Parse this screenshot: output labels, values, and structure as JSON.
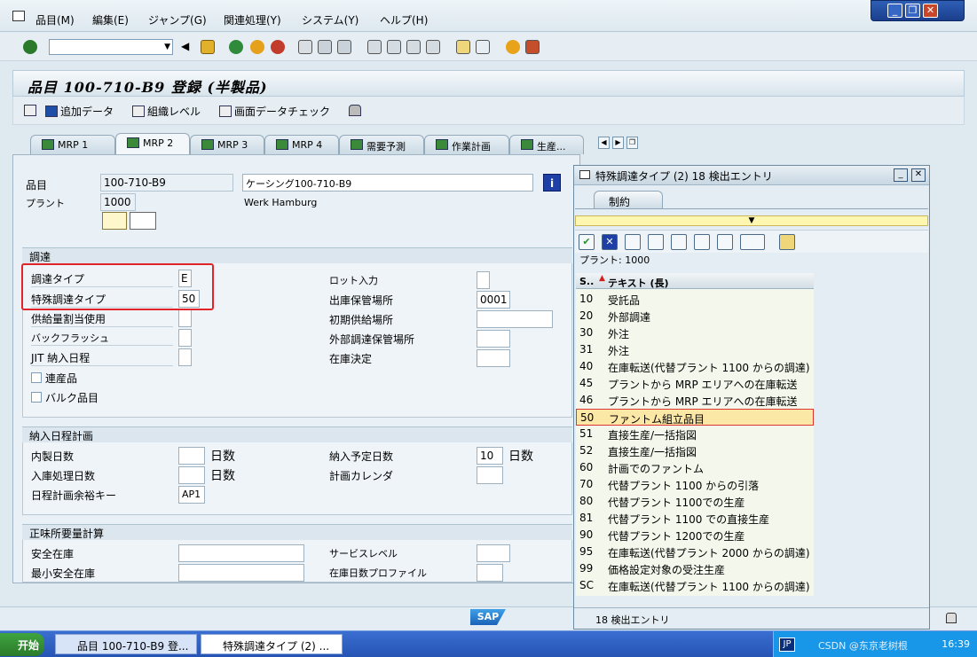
{
  "menu": {
    "items": [
      "品目(M)",
      "編集(E)",
      "ジャンプ(G)",
      "関連処理(Y)",
      "システム(Y)",
      "ヘルプ(H)"
    ]
  },
  "window_controls": [
    "minimize",
    "restore",
    "close"
  ],
  "command_field": {
    "value": ""
  },
  "title": "品目 100-710-B9 登録 (半製品)",
  "app_toolbar": {
    "additional_data": "追加データ",
    "org_levels": "組織レベル",
    "check_screen_data": "画面データチェック"
  },
  "tabs": [
    "MRP 1",
    "MRP 2",
    "MRP 3",
    "MRP 4",
    "需要予測",
    "作業計画",
    "生産..."
  ],
  "active_tab": "MRP 2",
  "header": {
    "material_label": "品目",
    "material_value": "100-710-B9",
    "material_desc": "ケーシング100-710-B9",
    "plant_label": "プラント",
    "plant_value": "1000",
    "plant_name": "Werk Hamburg"
  },
  "procurement": {
    "title": "調達",
    "proc_type_label": "調達タイプ",
    "proc_type_value": "E",
    "special_proc_label": "特殊調達タイプ",
    "special_proc_value": "50",
    "quota_label": "供給量割当使用",
    "backflush_label": "バックフラッシュ",
    "jit_label": "JIT 納入日程",
    "coproduct_label": "連産品",
    "bulk_label": "バルク品目",
    "batch_entry_label": "ロット入力",
    "prod_stor_label": "出庫保管場所",
    "prod_stor_value": "0001",
    "default_supply_label": "初期供給場所",
    "ext_stor_label": "外部調達保管場所",
    "stock_det_label": "在庫決定"
  },
  "scheduling": {
    "title": "納入日程計画",
    "inhouse_label": "内製日数",
    "gr_label": "入庫処理日数",
    "margin_label": "日程計画余裕キー",
    "margin_value": "AP1",
    "days_unit": "日数",
    "planned_del_label": "納入予定日数",
    "planned_del_value": "10",
    "calendar_label": "計画カレンダ"
  },
  "net_req": {
    "title": "正味所要量計算",
    "safety_label": "安全在庫",
    "min_safety_label": "最小安全在庫",
    "service_label": "サービスレベル",
    "coverage_label": "在庫日数プロファイル"
  },
  "popup": {
    "title": "特殊調達タイプ (2)   18 検出エントリ",
    "tab": "制約",
    "plant_line": "プラント: 1000",
    "col1": "S..",
    "col2": "テキスト (長)",
    "rows": [
      {
        "code": "10",
        "text": "受託品"
      },
      {
        "code": "20",
        "text": "外部調達"
      },
      {
        "code": "30",
        "text": "外注"
      },
      {
        "code": "31",
        "text": "外注"
      },
      {
        "code": "40",
        "text": "在庫転送(代替プラント 1100 からの調達)"
      },
      {
        "code": "45",
        "text": "プラントから MRP エリアへの在庫転送"
      },
      {
        "code": "46",
        "text": "プラントから MRP エリアへの在庫転送"
      },
      {
        "code": "50",
        "text": "ファントム組立品目"
      },
      {
        "code": "51",
        "text": "直接生産/一括指図"
      },
      {
        "code": "52",
        "text": "直接生産/一括指図"
      },
      {
        "code": "60",
        "text": "計画でのファントム"
      },
      {
        "code": "70",
        "text": "代替プラント 1100 からの引落"
      },
      {
        "code": "80",
        "text": "代替プラント 1100での生産"
      },
      {
        "code": "81",
        "text": "代替プラント 1100 での直接生産"
      },
      {
        "code": "90",
        "text": "代替プラント 1200での生産"
      },
      {
        "code": "95",
        "text": "在庫転送(代替プラント 2000 からの調達)"
      },
      {
        "code": "99",
        "text": "価格設定対象の受注生産"
      },
      {
        "code": "SC",
        "text": "在庫転送(代替プラント 1100 からの調達)"
      }
    ],
    "selected_code": "50",
    "status": "18 検出エントリ"
  },
  "taskbar": {
    "start": "开始",
    "task1": "品目 100-710-B9 登...",
    "task2": "特殊調達タイプ (2) ...",
    "lang": "JP",
    "time": "16:39",
    "watermark": "CSDN @东京老树根"
  },
  "sap_logo": "SAP"
}
